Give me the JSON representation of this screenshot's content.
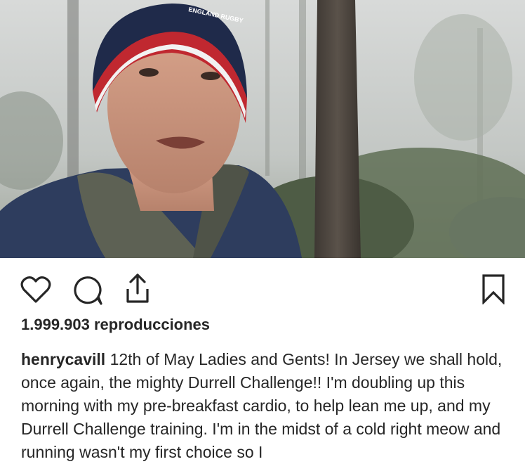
{
  "post": {
    "media": {
      "type": "video",
      "beanie_text": "ENGLAND RUGBY"
    },
    "actions": {
      "like_icon": "heart-icon",
      "comment_icon": "comment-icon",
      "share_icon": "share-icon",
      "save_icon": "bookmark-icon"
    },
    "views": "1.999.903 reproducciones",
    "caption": {
      "username": "henrycavill",
      "text": "12th of May Ladies and Gents! In Jersey we shall hold, once again, the mighty Durrell Challenge!! I'm doubling up this morning with my pre-breakfast cardio, to help lean me up, and my Durrell Challenge training. I'm in the midst of a cold right meow and running wasn't my first choice so I"
    }
  }
}
